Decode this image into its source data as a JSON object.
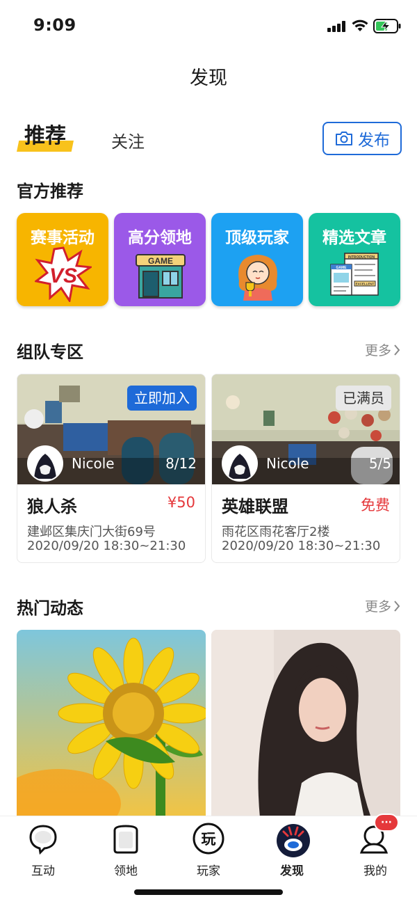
{
  "status_bar": {
    "time": "9:09"
  },
  "header": {
    "title": "发现"
  },
  "tabs": {
    "recommend": "推荐",
    "follow": "关注",
    "publish_label": "发布"
  },
  "official": {
    "title": "官方推荐",
    "items": [
      {
        "label": "赛事活动",
        "color": "#f7b500"
      },
      {
        "label": "高分领地",
        "color": "#9b59e8"
      },
      {
        "label": "顶级玩家",
        "color": "#1da1f2"
      },
      {
        "label": "精选文章",
        "color": "#15c2a0"
      }
    ],
    "icon_texts": {
      "vs": "VS",
      "game": "GAME",
      "intro": "INTRODUCTION",
      "excellent": "EXCELLENT"
    }
  },
  "team": {
    "title": "组队专区",
    "more": "更多",
    "cards": [
      {
        "badge": "立即加入",
        "nick": "Nicole",
        "count": "8/12",
        "name": "狼人杀",
        "price": "¥50",
        "address": "建邺区集庆门大街69号",
        "datetime": "2020/09/20   18:30~21:30"
      },
      {
        "badge": "已满员",
        "nick": "Nicole",
        "count": "5/5",
        "name": "英雄联盟",
        "price": "免费",
        "address": "雨花区雨花客厅2楼",
        "datetime": "2020/09/20   18:30~21:30"
      }
    ]
  },
  "hot": {
    "title": "热门动态",
    "more": "更多"
  },
  "tabbar": {
    "items": [
      {
        "label": "互动"
      },
      {
        "label": "领地"
      },
      {
        "label": "玩家",
        "glyph": "玩"
      },
      {
        "label": "发现"
      },
      {
        "label": "我的",
        "badge": "···"
      }
    ]
  },
  "colors": {
    "accent": "#1e6ad8",
    "highlight": "#f8c21c",
    "price": "#e5383b"
  }
}
